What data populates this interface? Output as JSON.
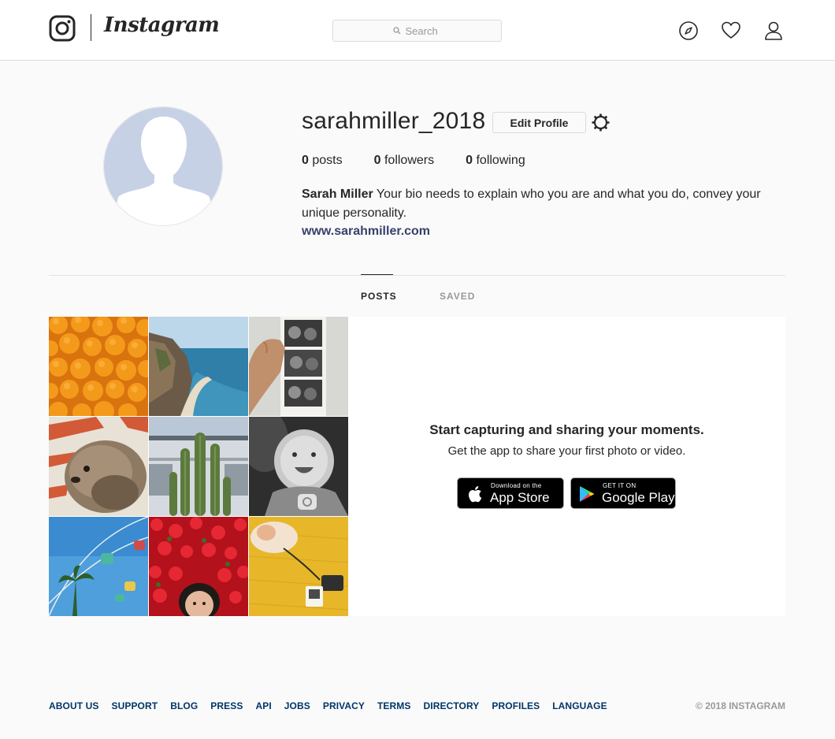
{
  "header": {
    "brand": "Instagram",
    "search_placeholder": "Search",
    "nav_icons": [
      "compass-icon",
      "heart-icon",
      "user-icon"
    ]
  },
  "profile": {
    "username": "sarahmiller_2018",
    "edit_button": "Edit Profile",
    "stats": {
      "posts_count": "0",
      "posts_label": "posts",
      "followers_count": "0",
      "followers_label": "followers",
      "following_count": "0",
      "following_label": "following"
    },
    "name": "Sarah Miller",
    "bio": "Your bio needs to explain who you are and what you do, convey your unique personality.",
    "website": "www.sarahmiller.com"
  },
  "tabs": [
    {
      "label": "POSTS",
      "active": true
    },
    {
      "label": "SAVED",
      "active": false
    }
  ],
  "cta": {
    "title": "Start capturing and sharing your moments.",
    "subtitle": "Get the app to share your first photo or video.",
    "app_store": {
      "small": "Download on the",
      "big": "App Store"
    },
    "google_play": {
      "small": "GET IT ON",
      "big": "Google Play"
    }
  },
  "footer": {
    "links": [
      "ABOUT US",
      "SUPPORT",
      "BLOG",
      "PRESS",
      "API",
      "JOBS",
      "PRIVACY",
      "TERMS",
      "DIRECTORY",
      "PROFILES",
      "LANGUAGE"
    ],
    "copyright": "© 2018 INSTAGRAM"
  },
  "colors": {
    "link": "#003569",
    "website": "#38416b",
    "muted": "#999999",
    "border": "#dbdbdb",
    "avatar_silhouette": "#c7d1e6"
  }
}
